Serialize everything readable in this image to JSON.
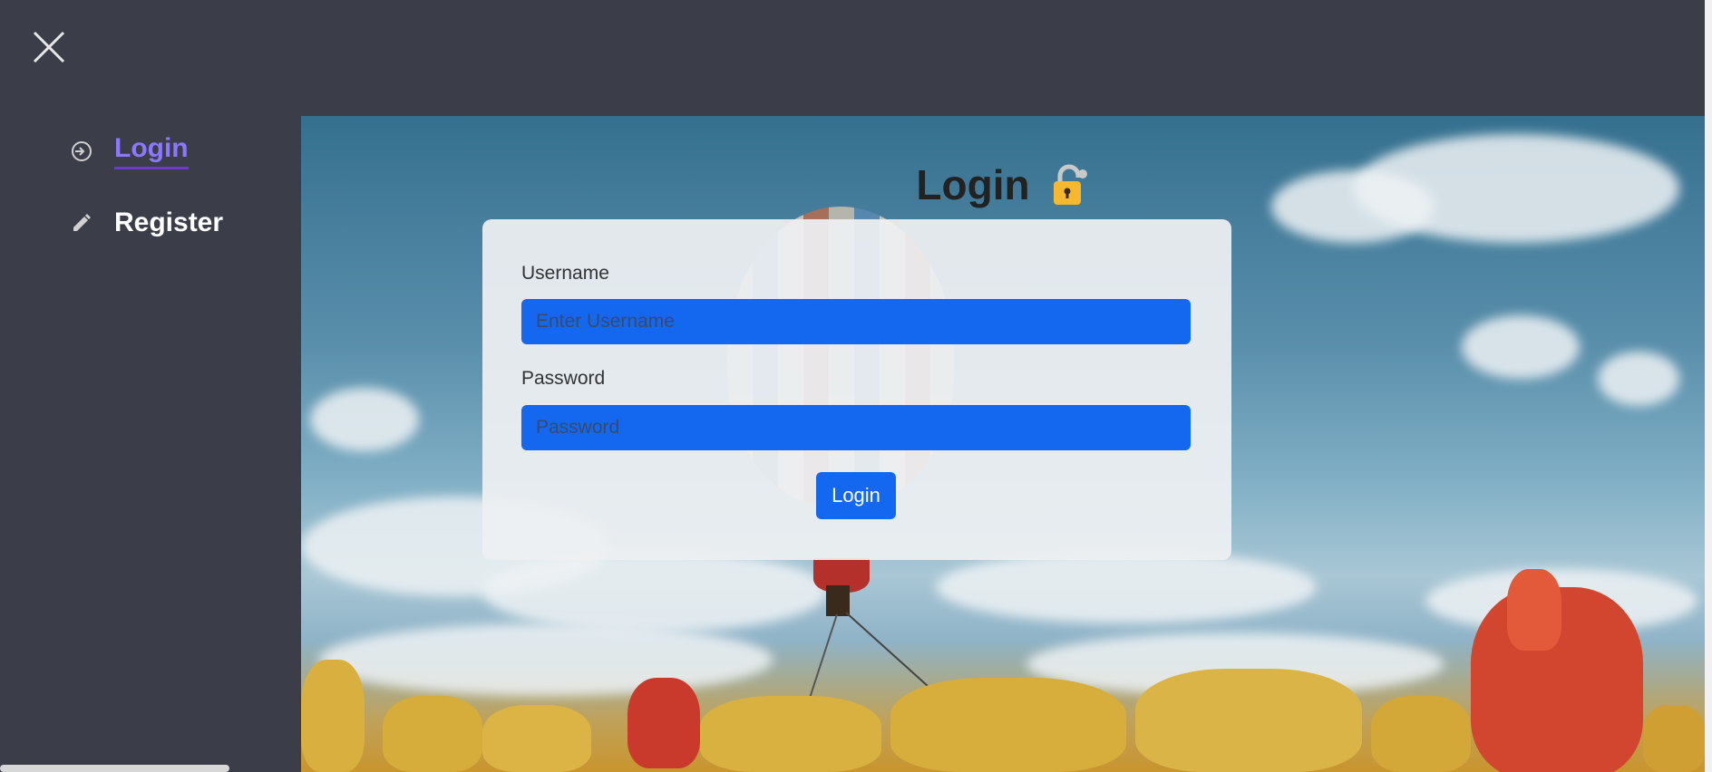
{
  "close_icon": "close-icon",
  "sidebar": {
    "items": [
      {
        "label": "Login",
        "icon": "login-icon",
        "active": true
      },
      {
        "label": "Register",
        "icon": "pencil-icon",
        "active": false
      }
    ]
  },
  "main": {
    "title": "Login",
    "title_icon": "lock-icon"
  },
  "form": {
    "username_label": "Username",
    "username_placeholder": "Enter Username",
    "username_value": "",
    "password_label": "Password",
    "password_placeholder": "Password",
    "password_value": "",
    "submit_label": "Login"
  },
  "colors": {
    "sidebar_bg": "#3b3e48",
    "accent": "#8c77ff",
    "input_bg": "#1467ef",
    "button_bg": "#1467ef"
  }
}
